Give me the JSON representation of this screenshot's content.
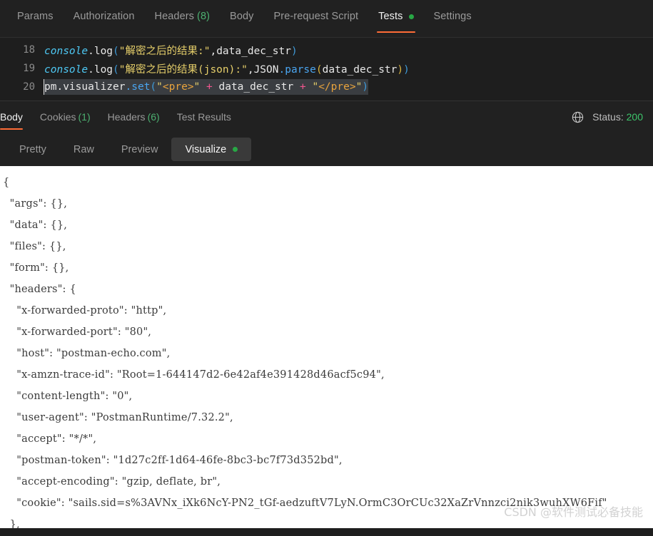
{
  "request_tabs": {
    "items": [
      {
        "label": "Params",
        "active": false,
        "count": null,
        "dot": false
      },
      {
        "label": "Authorization",
        "active": false,
        "count": null,
        "dot": false
      },
      {
        "label": "Headers",
        "active": false,
        "count": "(8)",
        "dot": false
      },
      {
        "label": "Body",
        "active": false,
        "count": null,
        "dot": false
      },
      {
        "label": "Pre-request Script",
        "active": false,
        "count": null,
        "dot": false
      },
      {
        "label": "Tests",
        "active": true,
        "count": null,
        "dot": true
      },
      {
        "label": "Settings",
        "active": false,
        "count": null,
        "dot": false
      }
    ]
  },
  "editor": {
    "lines": [
      {
        "number": "18"
      },
      {
        "number": "19"
      },
      {
        "number": "20"
      }
    ],
    "line18": {
      "object": "console",
      "method": ".log",
      "open_paren": "(",
      "string": "\"解密之后的结果:\"",
      "comma": ",",
      "arg": "data_dec_str",
      "close_paren": ")"
    },
    "line19": {
      "object": "console",
      "method": ".log",
      "open_paren": "(",
      "string": "\"解密之后的结果(json):\"",
      "comma": ",",
      "json_object": "JSON",
      "json_method": ".parse",
      "inner_open": "(",
      "arg": "data_dec_str",
      "inner_close": ")",
      "close_paren": ")"
    },
    "line20": {
      "object": "pm",
      "prop1": ".visualizer",
      "method": ".set",
      "open_paren": "(",
      "str_open_quote": "\"",
      "tag_open": "<pre>",
      "str_close_quote1": "\"",
      "plus1": "+",
      "arg": "data_dec_str",
      "plus2": "+",
      "str_open_quote2": "\"",
      "tag_close": "</pre>",
      "str_close_quote2": "\"",
      "close_paren": ")"
    }
  },
  "response_tabs": {
    "items": [
      {
        "label": "Body",
        "active": true,
        "count": null
      },
      {
        "label": "Cookies",
        "active": false,
        "count": "(1)"
      },
      {
        "label": "Headers",
        "active": false,
        "count": "(6)"
      },
      {
        "label": "Test Results",
        "active": false,
        "count": null
      }
    ],
    "status_label": "Status:",
    "status_code": "200",
    "globe_icon": "globe-icon"
  },
  "view_tabs": {
    "items": [
      {
        "label": "Pretty",
        "active": false,
        "dot": false
      },
      {
        "label": "Raw",
        "active": false,
        "dot": false
      },
      {
        "label": "Preview",
        "active": false,
        "dot": false
      },
      {
        "label": "Visualize",
        "active": true,
        "dot": true
      }
    ]
  },
  "visualize": {
    "content": "{\n  \"args\": {},\n  \"data\": {},\n  \"files\": {},\n  \"form\": {},\n  \"headers\": {\n    \"x-forwarded-proto\": \"http\",\n    \"x-forwarded-port\": \"80\",\n    \"host\": \"postman-echo.com\",\n    \"x-amzn-trace-id\": \"Root=1-644147d2-6e42af4e391428d46acf5c94\",\n    \"content-length\": \"0\",\n    \"user-agent\": \"PostmanRuntime/7.32.2\",\n    \"accept\": \"*/*\",\n    \"postman-token\": \"1d27c2ff-1d64-46fe-8bc3-bc7f73d352bd\",\n    \"accept-encoding\": \"gzip, deflate, br\",\n    \"cookie\": \"sails.sid=s%3AVNx_iXk6NcY-PN2_tGf-aedzuftV7LyN.OrmC3OrCUc32XaZrVnnzci2nik3wuhXW6Fif\"\n  },"
  },
  "watermark": {
    "text": "CSDN @软件测试必备技能"
  },
  "colors": {
    "accent_orange": "#ff6c37",
    "status_green": "#3dc66b",
    "dot_green": "#28a745",
    "dark_bg": "#212121",
    "editor_bg": "#1e1e1e",
    "body_bg": "#ffffff"
  }
}
